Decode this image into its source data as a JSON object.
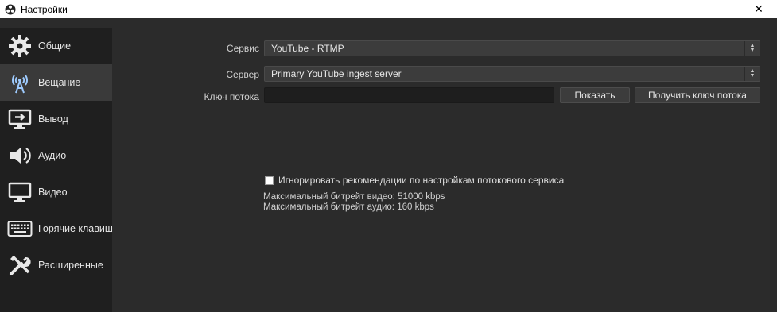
{
  "window": {
    "title": "Настройки",
    "close_symbol": "✕",
    "app_icon": "obs-logo-icon"
  },
  "sidebar": {
    "items": [
      {
        "label": "Общие",
        "icon": "gear-icon",
        "active": false
      },
      {
        "label": "Вещание",
        "icon": "broadcast-antenna-icon",
        "active": true
      },
      {
        "label": "Вывод",
        "icon": "output-monitor-icon",
        "active": false
      },
      {
        "label": "Аудио",
        "icon": "speaker-icon",
        "active": false
      },
      {
        "label": "Видео",
        "icon": "monitor-icon",
        "active": false
      },
      {
        "label": "Горячие клавиш",
        "icon": "keyboard-icon",
        "active": false
      },
      {
        "label": "Расширенные",
        "icon": "tools-icon",
        "active": false
      }
    ]
  },
  "stream": {
    "service_label": "Сервис",
    "service_value": "YouTube - RTMP",
    "server_label": "Сервер",
    "server_value": "Primary YouTube ingest server",
    "key_label": "Ключ потока",
    "key_value": "",
    "show_button": "Показать",
    "get_key_button": "Получить ключ потока",
    "ignore_checkbox_label": "Игнорировать рекомендации по настройкам потокового сервиса",
    "ignore_checked": false,
    "max_video_bitrate": "Максимальный битрейт видео: 51000 kbps",
    "max_audio_bitrate": "Максимальный битрейт аудио: 160 kbps"
  },
  "colors": {
    "background": "#2b2b2b",
    "sidebar": "#1f1f1f",
    "active_item": "#3a3a3a",
    "control": "#3c3c3c"
  }
}
